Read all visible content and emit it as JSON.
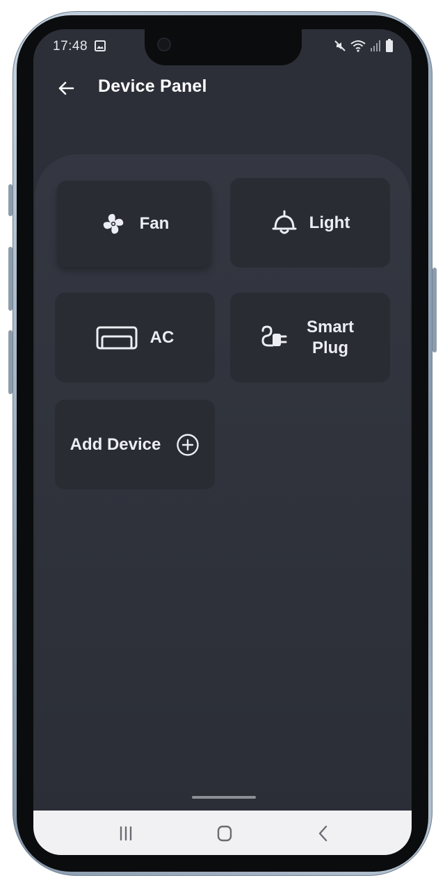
{
  "status_bar": {
    "time": "17:48",
    "left_icons": [
      "image-icon"
    ],
    "right_icons": [
      "mute-icon",
      "wifi-icon",
      "signal-icon",
      "battery-icon"
    ]
  },
  "app_bar": {
    "back_icon": "arrow-left-icon",
    "title": "Device Panel"
  },
  "devices": [
    {
      "label": "Fan",
      "icon": "fan-icon"
    },
    {
      "label": "Light",
      "icon": "lamp-icon"
    },
    {
      "label": "AC",
      "icon": "air-conditioner-icon"
    },
    {
      "label": "Smart Plug",
      "icon": "plug-icon"
    }
  ],
  "add_device": {
    "label": "Add Device",
    "icon": "plus-circle-icon"
  },
  "navigation": {
    "buttons": [
      "recent-apps-icon",
      "home-icon",
      "back-icon"
    ]
  },
  "colors": {
    "background": "#2d2f38",
    "panel": "#343741",
    "tile": "#2a2c34",
    "text": "#eceef3",
    "nav_bar": "#f1f1f3"
  }
}
